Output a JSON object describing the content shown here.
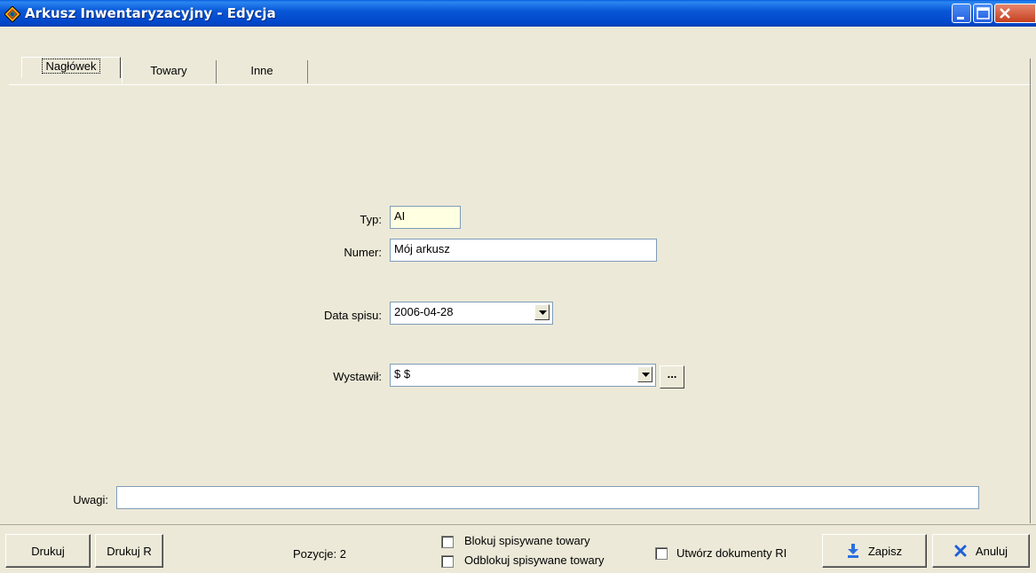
{
  "window": {
    "title": "Arkusz Inwentaryzacyjny - Edycja"
  },
  "tabs": [
    {
      "label": "Nagłówek"
    },
    {
      "label": "Towary"
    },
    {
      "label": "Inne"
    }
  ],
  "form": {
    "typ": {
      "label": "Typ:",
      "value": "AI"
    },
    "numer": {
      "label": "Numer:",
      "value": "Mój arkusz"
    },
    "data_spisu": {
      "label": "Data spisu:",
      "value": "2006-04-28"
    },
    "wystawil": {
      "label": "Wystawił:",
      "value": "$ $",
      "more_label": "..."
    },
    "uwagi": {
      "label": "Uwagi:",
      "value": ""
    }
  },
  "footer": {
    "drukuj_label": "Drukuj",
    "drukuj_r_label": "Drukuj R",
    "pozycje_text": "Pozycje: 2",
    "checkboxes": {
      "blokuj": {
        "label": "Blokuj spisywane towary",
        "checked": false
      },
      "odblokuj": {
        "label": "Odblokuj spisywane towary",
        "checked": false
      },
      "utworz": {
        "label": "Utwórz dokumenty RI",
        "checked": false
      }
    },
    "zapisz_label": "Zapisz",
    "anuluj_label": "Anuluj"
  },
  "colors": {
    "titlebar": "#0858d8",
    "window_bg": "#ece9d8",
    "field_highlight": "#ffffe1"
  },
  "icons": {
    "app": "app-diamond-icon",
    "minimize": "minimize-icon",
    "maximize": "maximize-icon",
    "close": "close-icon",
    "save": "save-arrow-icon",
    "cancel": "cancel-x-icon"
  }
}
